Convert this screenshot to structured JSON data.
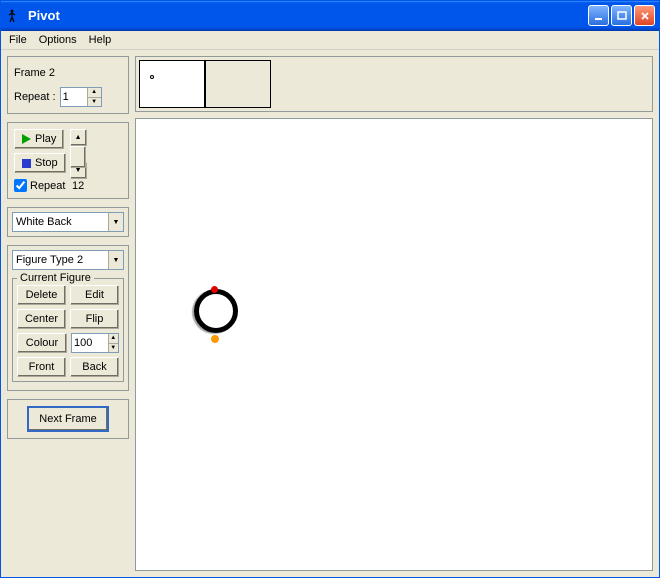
{
  "window": {
    "title": "Pivot"
  },
  "menu": {
    "file": "File",
    "options": "Options",
    "help": "Help"
  },
  "framePanel": {
    "frame_label": "Frame 2",
    "repeat_label": "Repeat :",
    "repeat_value": "1"
  },
  "playPanel": {
    "play": "Play",
    "stop": "Stop",
    "repeat_cb": "Repeat",
    "fps": "12"
  },
  "backDropdown": {
    "value": "White Back"
  },
  "figureTypeDropdown": {
    "value": "Figure Type 2"
  },
  "currentFigure": {
    "legend": "Current Figure",
    "delete": "Delete",
    "edit": "Edit",
    "center": "Center",
    "flip": "Flip",
    "colour": "Colour",
    "size": "100",
    "front": "Front",
    "back": "Back"
  },
  "nextFrame": {
    "label": "Next Frame"
  }
}
